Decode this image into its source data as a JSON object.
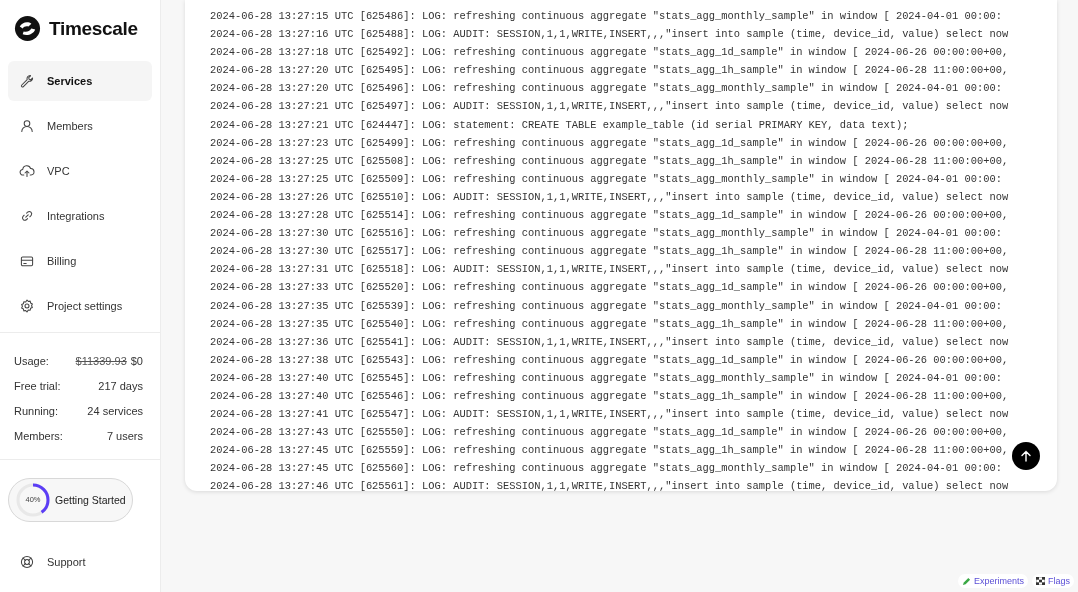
{
  "brand": {
    "name": "Timescale"
  },
  "nav": [
    {
      "label": "Services",
      "selected": true
    },
    {
      "label": "Members",
      "selected": false
    },
    {
      "label": "VPC",
      "selected": false
    },
    {
      "label": "Integrations",
      "selected": false
    },
    {
      "label": "Billing",
      "selected": false
    },
    {
      "label": "Project settings",
      "selected": false
    }
  ],
  "stats": [
    {
      "label": "Usage:",
      "old_value": "$11339.93",
      "value": "$0"
    },
    {
      "label": "Free trial:",
      "value": "217 days"
    },
    {
      "label": "Running:",
      "value": "24 services"
    },
    {
      "label": "Members:",
      "value": "7 users"
    }
  ],
  "getting_started": {
    "label": "Getting Started",
    "percent": "40%",
    "level": 0.4
  },
  "support": {
    "label": "Support"
  },
  "log_lines": [
    "2024-06-28 13:27:15 UTC [625486]: LOG: refreshing continuous aggregate \"stats_agg_monthly_sample\" in window [ 2024-04-01 00:00:",
    "2024-06-28 13:27:16 UTC [625488]: LOG: AUDIT: SESSION,1,1,WRITE,INSERT,,,\"insert into sample (time, device_id, value) select now",
    "2024-06-28 13:27:18 UTC [625492]: LOG: refreshing continuous aggregate \"stats_agg_1d_sample\" in window [ 2024-06-26 00:00:00+00,",
    "2024-06-28 13:27:20 UTC [625495]: LOG: refreshing continuous aggregate \"stats_agg_1h_sample\" in window [ 2024-06-28 11:00:00+00,",
    "2024-06-28 13:27:20 UTC [625496]: LOG: refreshing continuous aggregate \"stats_agg_monthly_sample\" in window [ 2024-04-01 00:00:",
    "2024-06-28 13:27:21 UTC [625497]: LOG: AUDIT: SESSION,1,1,WRITE,INSERT,,,\"insert into sample (time, device_id, value) select now",
    "2024-06-28 13:27:21 UTC [624447]: LOG: statement: CREATE TABLE example_table (id serial PRIMARY KEY, data text);",
    "2024-06-28 13:27:23 UTC [625499]: LOG: refreshing continuous aggregate \"stats_agg_1d_sample\" in window [ 2024-06-26 00:00:00+00,",
    "2024-06-28 13:27:25 UTC [625508]: LOG: refreshing continuous aggregate \"stats_agg_1h_sample\" in window [ 2024-06-28 11:00:00+00,",
    "2024-06-28 13:27:25 UTC [625509]: LOG: refreshing continuous aggregate \"stats_agg_monthly_sample\" in window [ 2024-04-01 00:00:",
    "2024-06-28 13:27:26 UTC [625510]: LOG: AUDIT: SESSION,1,1,WRITE,INSERT,,,\"insert into sample (time, device_id, value) select now",
    "2024-06-28 13:27:28 UTC [625514]: LOG: refreshing continuous aggregate \"stats_agg_1d_sample\" in window [ 2024-06-26 00:00:00+00,",
    "2024-06-28 13:27:30 UTC [625516]: LOG: refreshing continuous aggregate \"stats_agg_monthly_sample\" in window [ 2024-04-01 00:00:",
    "2024-06-28 13:27:30 UTC [625517]: LOG: refreshing continuous aggregate \"stats_agg_1h_sample\" in window [ 2024-06-28 11:00:00+00,",
    "2024-06-28 13:27:31 UTC [625518]: LOG: AUDIT: SESSION,1,1,WRITE,INSERT,,,\"insert into sample (time, device_id, value) select now",
    "2024-06-28 13:27:33 UTC [625520]: LOG: refreshing continuous aggregate \"stats_agg_1d_sample\" in window [ 2024-06-26 00:00:00+00,",
    "2024-06-28 13:27:35 UTC [625539]: LOG: refreshing continuous aggregate \"stats_agg_monthly_sample\" in window [ 2024-04-01 00:00:",
    "2024-06-28 13:27:35 UTC [625540]: LOG: refreshing continuous aggregate \"stats_agg_1h_sample\" in window [ 2024-06-28 11:00:00+00,",
    "2024-06-28 13:27:36 UTC [625541]: LOG: AUDIT: SESSION,1,1,WRITE,INSERT,,,\"insert into sample (time, device_id, value) select now",
    "2024-06-28 13:27:38 UTC [625543]: LOG: refreshing continuous aggregate \"stats_agg_1d_sample\" in window [ 2024-06-26 00:00:00+00,",
    "2024-06-28 13:27:40 UTC [625545]: LOG: refreshing continuous aggregate \"stats_agg_monthly_sample\" in window [ 2024-04-01 00:00:",
    "2024-06-28 13:27:40 UTC [625546]: LOG: refreshing continuous aggregate \"stats_agg_1h_sample\" in window [ 2024-06-28 11:00:00+00,",
    "2024-06-28 13:27:41 UTC [625547]: LOG: AUDIT: SESSION,1,1,WRITE,INSERT,,,\"insert into sample (time, device_id, value) select now",
    "2024-06-28 13:27:43 UTC [625550]: LOG: refreshing continuous aggregate \"stats_agg_1d_sample\" in window [ 2024-06-26 00:00:00+00,",
    "2024-06-28 13:27:45 UTC [625559]: LOG: refreshing continuous aggregate \"stats_agg_1h_sample\" in window [ 2024-06-28 11:00:00+00,",
    "2024-06-28 13:27:45 UTC [625560]: LOG: refreshing continuous aggregate \"stats_agg_monthly_sample\" in window [ 2024-04-01 00:00:",
    "2024-06-28 13:27:46 UTC [625561]: LOG: AUDIT: SESSION,1,1,WRITE,INSERT,,,\"insert into sample (time, device_id, value) select now"
  ],
  "footer_links": [
    {
      "label": "Experiments"
    },
    {
      "label": "Flags"
    }
  ]
}
